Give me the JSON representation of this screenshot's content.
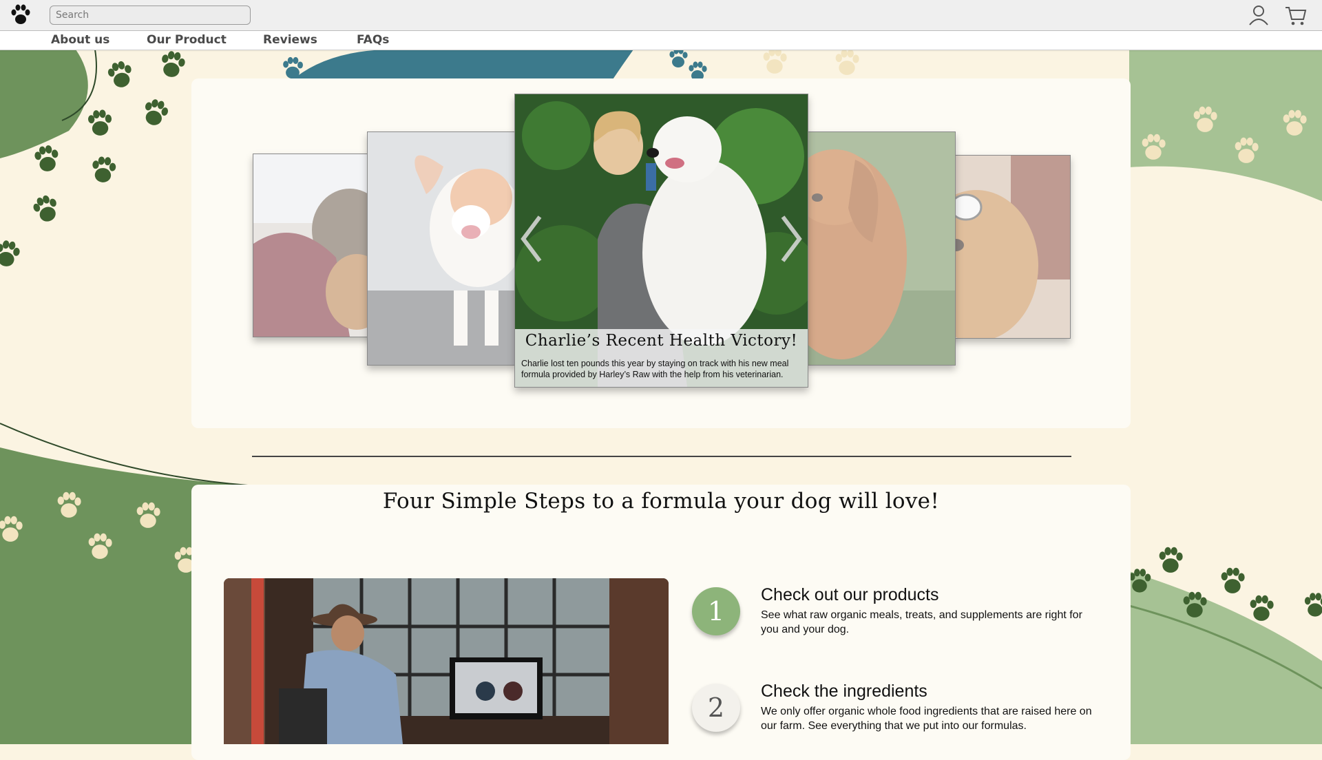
{
  "header": {
    "search_placeholder": "Search",
    "logo_icon": "paw-icon",
    "account_icon": "user-icon",
    "cart_icon": "cart-icon"
  },
  "nav": {
    "items": [
      {
        "label": "About us"
      },
      {
        "label": "Our Product"
      },
      {
        "label": "Reviews"
      },
      {
        "label": "FAQs"
      }
    ]
  },
  "carousel": {
    "active": {
      "title": "Charlie’s Recent Health Victory!",
      "text": "Charlie lost ten pounds this year by staying on track with his new meal formula provided by Harley’s Raw with the help from his veterinarian."
    },
    "prev_icon": "chevron-left-icon",
    "next_icon": "chevron-right-icon"
  },
  "steps": {
    "heading": "Four Simple Steps to a formula your dog will love!",
    "items": [
      {
        "number": "1",
        "title": "Check out our products",
        "text": "See what raw organic meals, treats, and supplements are right for you and your dog."
      },
      {
        "number": "2",
        "title": "Check the ingredients",
        "text": "We only offer organic whole food ingredients that are raised here on our farm. See everything that we put into our formulas."
      }
    ]
  },
  "colors": {
    "cream": "#fbf4e2",
    "green": "#6e935c",
    "light_green": "#a6c294",
    "teal": "#3c7a8c",
    "step1": "#8db47a",
    "step2": "#f3f1ec"
  }
}
